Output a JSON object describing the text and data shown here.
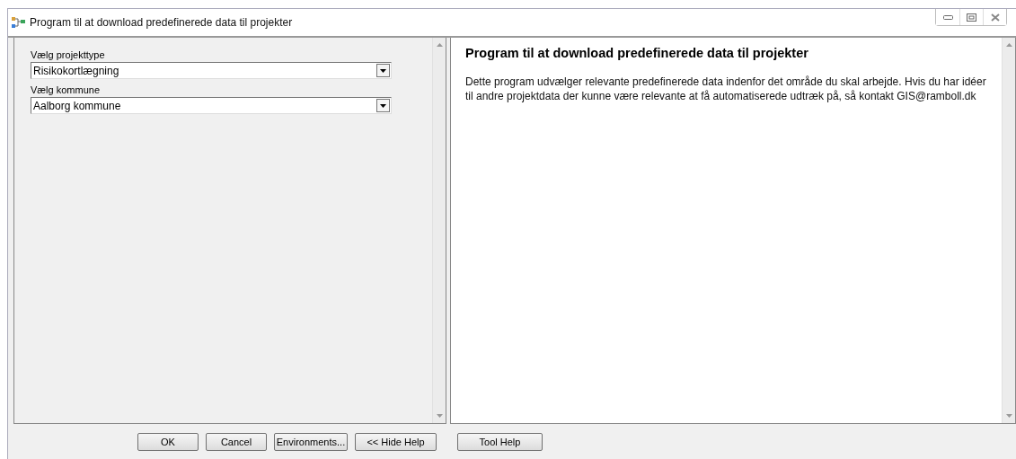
{
  "window": {
    "title": "Program til at download predefinerede data til projekter"
  },
  "parameters": [
    {
      "label": "Vælg projekttype",
      "value": "Risikokortlægning"
    },
    {
      "label": "Vælg kommune",
      "value": "Aalborg kommune"
    }
  ],
  "help": {
    "title": "Program til at download predefinerede data til projekter",
    "text": "Dette program udvælger relevante predefinerede data indenfor det område du skal arbejde. Hvis du har idéer til andre projektdata der kunne være relevante at få automatiserede udtræk på, så kontakt GIS@ramboll.dk"
  },
  "buttons": [
    {
      "label": "OK"
    },
    {
      "label": "Cancel"
    },
    {
      "label": "Environments..."
    },
    {
      "label": "<< Hide Help"
    },
    {
      "label": "Tool Help",
      "kind": "separate"
    }
  ]
}
